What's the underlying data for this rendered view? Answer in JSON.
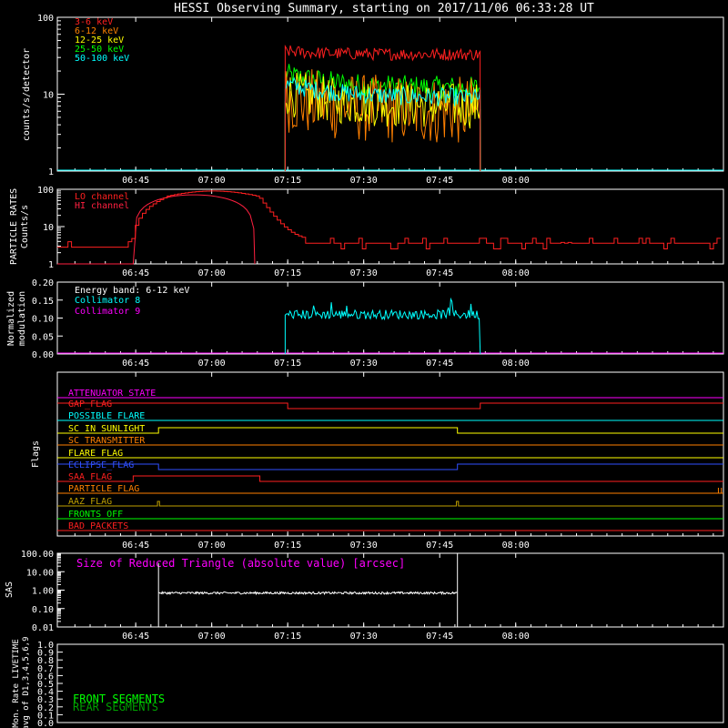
{
  "title": "HESSI Observing Summary, starting on 2017/11/06 06:33:28 UT",
  "time_labels": [
    "06:45",
    "07:00",
    "07:15",
    "07:30",
    "07:45",
    "08:00"
  ],
  "time_range_min": [
    -3.47,
    128.0
  ],
  "time_ticks_min": [
    12,
    27,
    42,
    57,
    72,
    87
  ],
  "panels": {
    "counts": {
      "ylabel": "counts/s/detector",
      "type": "line",
      "yscale": "log",
      "ylim": [
        1,
        100
      ],
      "ytick_labels": [
        "1",
        "10",
        "100"
      ],
      "legend_location": "top-left",
      "series": [
        {
          "name": "3-6 keV",
          "color": "#ff2020",
          "level": 33,
          "spread": 0.08,
          "start": 41.5,
          "end": 80.0
        },
        {
          "name": "6-12 keV",
          "color": "#ff8000",
          "level": 6.0,
          "spread": 0.45,
          "start": 41.5,
          "end": 80.0
        },
        {
          "name": "12-25 keV",
          "color": "#ffff00",
          "level": 7.0,
          "spread": 0.3,
          "start": 41.5,
          "end": 80.0
        },
        {
          "name": "25-50 keV",
          "color": "#00ff00",
          "level": 12.0,
          "spread": 0.15,
          "start": 41.5,
          "end": 80.0
        },
        {
          "name": "50-100 keV",
          "color": "#00ffff",
          "level": 9.0,
          "spread": 0.12,
          "start": 41.5,
          "end": 80.0
        }
      ]
    },
    "particle": {
      "ylabel_lines": [
        "PARTICLE RATES",
        "Counts/s"
      ],
      "yscale": "log",
      "ylim": [
        1,
        100
      ],
      "ytick_labels": [
        "1",
        "10",
        "100"
      ],
      "legend_location": "top-left",
      "series": [
        {
          "name": "LO channel",
          "color": "#ff2020"
        },
        {
          "name": "HI channel",
          "color": "#ff2040"
        }
      ]
    },
    "modulation": {
      "ylabel_lines": [
        "Normalized",
        "modulation"
      ],
      "ylim": [
        0.0,
        0.2
      ],
      "ytick_labels": [
        "0.00",
        "0.05",
        "0.10",
        "0.15",
        "0.20"
      ],
      "annotation": "Energy band: 6-12 keV",
      "legend_location": "top-left",
      "series": [
        {
          "name": "Collimator 8",
          "color": "#00ffff",
          "level": 0.11,
          "spread": 0.013,
          "start": 41.5,
          "end": 80.0
        },
        {
          "name": "Collimator 9",
          "color": "#ff00ff",
          "level": 0.0
        }
      ]
    },
    "flags": {
      "ylabel": "Flags",
      "items": [
        {
          "name": "ATTENUATOR_STATE",
          "color": "#ff00ff"
        },
        {
          "name": "GAP_FLAG",
          "color": "#ff2020"
        },
        {
          "name": "POSSIBLE_FLARE",
          "color": "#00ffff"
        },
        {
          "name": "SC_IN_SUNLIGHT",
          "color": "#ffff00"
        },
        {
          "name": "SC_TRANSMITTER",
          "color": "#ff8000"
        },
        {
          "name": "FLARE_FLAG",
          "color": "#ffff00"
        },
        {
          "name": "ECLIPSE_FLAG",
          "color": "#3050ff"
        },
        {
          "name": "SAA_FLAG",
          "color": "#ff2020"
        },
        {
          "name": "PARTICLE_FLAG",
          "color": "#ff8000"
        },
        {
          "name": "AAZ_FLAG",
          "color": "#c0a000"
        },
        {
          "name": "FRONTS_OFF",
          "color": "#00ff00"
        },
        {
          "name": "BAD_PACKETS",
          "color": "#ff2020"
        }
      ]
    },
    "sas": {
      "ylabel": "SAS",
      "yscale": "log",
      "ylim": [
        0.01,
        100
      ],
      "ytick_labels": [
        "0.01",
        "0.10",
        "1.00",
        "10.00",
        "100.00"
      ],
      "annotation": "Size of Reduced Triangle (absolute value) [arcsec]",
      "annotation_color": "#ff00ff",
      "level": 0.7,
      "start": 16.5,
      "end": 75.5
    },
    "livetime": {
      "ylabel_lines": [
        "Mon. Rate LIVETIME",
        "avg of D1,3,4,5,6,9"
      ],
      "ylim": [
        0.0,
        1.0
      ],
      "ytick_labels": [
        "0.0",
        "0.1",
        "0.2",
        "0.3",
        "0.4",
        "0.5",
        "0.6",
        "0.7",
        "0.8",
        "0.9",
        "1.0"
      ],
      "legend": [
        {
          "name": "FRONT SEGMENTS",
          "color": "#00ff00"
        },
        {
          "name": "REAR SEGMENTS",
          "color": "#00a000"
        }
      ]
    }
  }
}
